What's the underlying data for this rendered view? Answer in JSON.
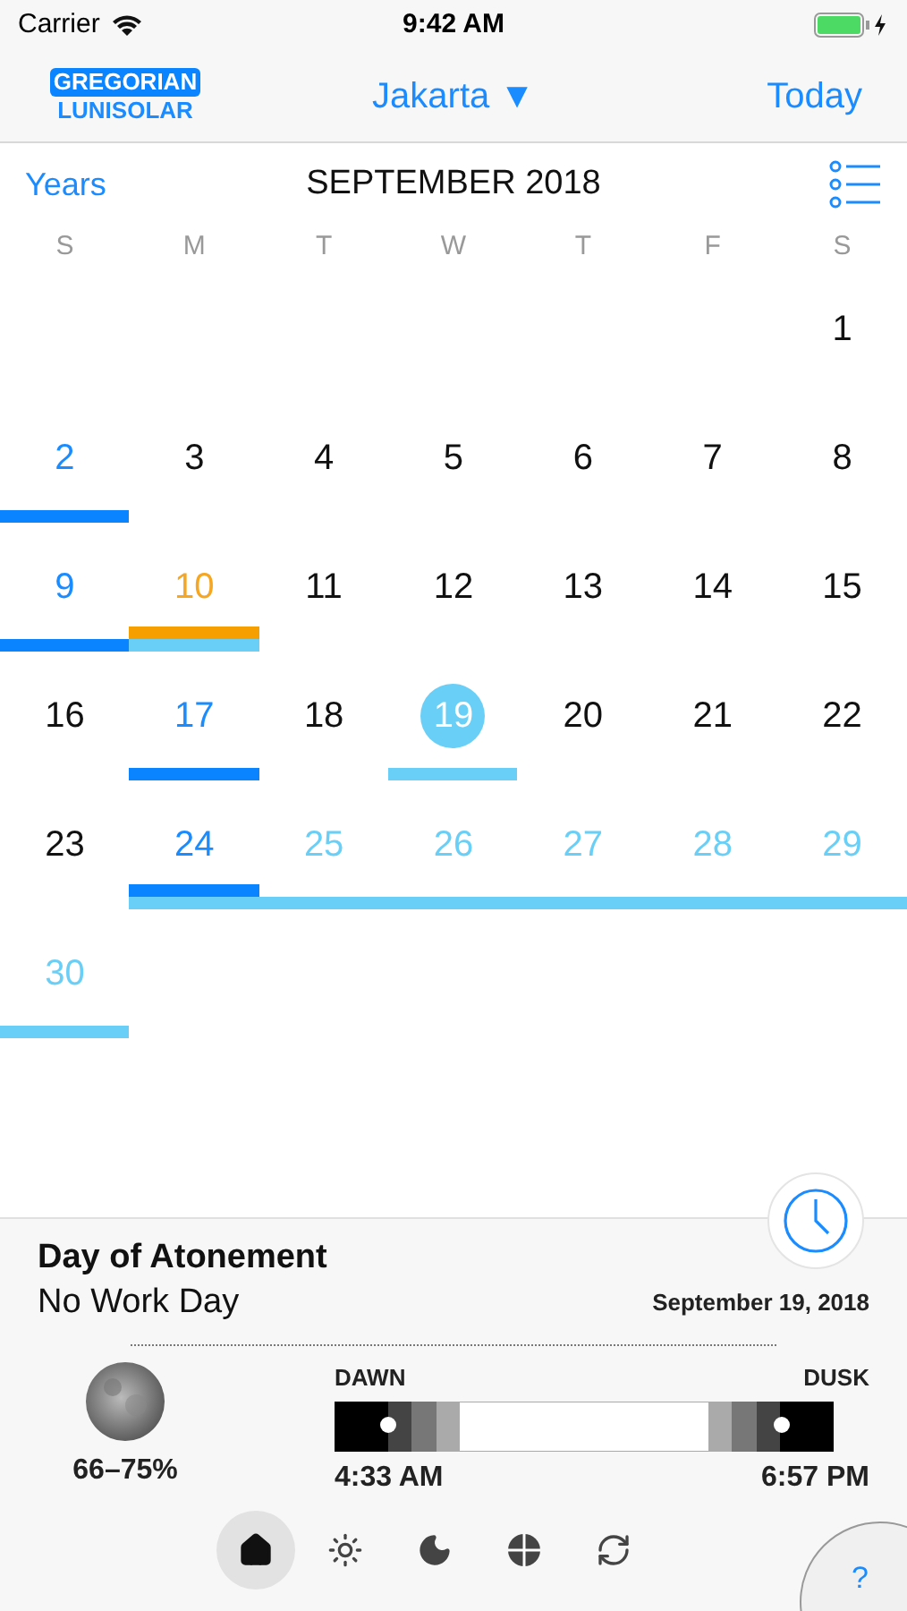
{
  "status_bar": {
    "carrier": "Carrier",
    "time": "9:42 AM"
  },
  "nav": {
    "calendars": [
      {
        "label": "GREGORIAN",
        "selected": true
      },
      {
        "label": "LUNISOLAR",
        "selected": false
      }
    ],
    "location": "Jakarta ▼",
    "today": "Today"
  },
  "month": {
    "years": "Years",
    "title": "SEPTEMBER 2018"
  },
  "weekdays": [
    "S",
    "M",
    "T",
    "W",
    "T",
    "F",
    "S"
  ],
  "weeks": [
    [
      {
        "label": "1",
        "color": "#111111",
        "selected": false
      }
    ],
    [
      {
        "label": "2",
        "color": "#1a8cff",
        "selected": false,
        "bars": [
          {
            "color": "#0a84ff"
          }
        ]
      },
      {
        "label": "3",
        "color": "#111111",
        "selected": false
      },
      {
        "label": "4",
        "color": "#111111",
        "selected": false
      },
      {
        "label": "5",
        "color": "#111111",
        "selected": false
      },
      {
        "label": "6",
        "color": "#111111",
        "selected": false
      },
      {
        "label": "7",
        "color": "#111111",
        "selected": false
      },
      {
        "label": "8",
        "color": "#111111",
        "selected": false
      }
    ],
    [
      {
        "label": "9",
        "color": "#1a8cff",
        "selected": false,
        "bars": [
          {
            "color": "#0a84ff"
          }
        ]
      },
      {
        "label": "10",
        "color": "#f5a623",
        "selected": false,
        "bars": [
          {
            "color": "#f5a000"
          },
          {
            "color": "#6acff6"
          }
        ]
      },
      {
        "label": "11",
        "color": "#111111",
        "selected": false
      },
      {
        "label": "12",
        "color": "#111111",
        "selected": false
      },
      {
        "label": "13",
        "color": "#111111",
        "selected": false
      },
      {
        "label": "14",
        "color": "#111111",
        "selected": false
      },
      {
        "label": "15",
        "color": "#111111",
        "selected": false
      }
    ],
    [
      {
        "label": "16",
        "color": "#111111",
        "selected": false
      },
      {
        "label": "17",
        "color": "#1a8cff",
        "selected": false,
        "bars": [
          {
            "color": "#0a84ff"
          }
        ]
      },
      {
        "label": "18",
        "color": "#111111",
        "selected": false
      },
      {
        "label": "19",
        "selected": true,
        "bars": [
          {
            "color": "#6acff6"
          }
        ]
      },
      {
        "label": "20",
        "color": "#111111",
        "selected": false
      },
      {
        "label": "21",
        "color": "#111111",
        "selected": false
      },
      {
        "label": "22",
        "color": "#111111",
        "selected": false
      }
    ],
    [
      {
        "label": "23",
        "color": "#111111",
        "selected": false
      },
      {
        "label": "24",
        "color": "#1a8cff",
        "selected": false,
        "bars": [
          {
            "color": "#0a84ff"
          },
          {
            "color": "#6acff6"
          }
        ]
      },
      {
        "label": "25",
        "color": "#6acff6",
        "selected": false,
        "bars": [
          {
            "color": "#6acff6"
          }
        ]
      },
      {
        "label": "26",
        "color": "#6acff6",
        "selected": false,
        "bars": [
          {
            "color": "#6acff6"
          }
        ]
      },
      {
        "label": "27",
        "color": "#6acff6",
        "selected": false,
        "bars": [
          {
            "color": "#6acff6"
          }
        ]
      },
      {
        "label": "28",
        "color": "#6acff6",
        "selected": false,
        "bars": [
          {
            "color": "#6acff6"
          }
        ]
      },
      {
        "label": "29",
        "color": "#6acff6",
        "selected": false,
        "bars": [
          {
            "color": "#6acff6"
          }
        ]
      }
    ],
    [
      {
        "label": "30",
        "color": "#6acff6",
        "selected": false,
        "bars": [
          {
            "color": "#6acff6"
          }
        ]
      }
    ]
  ],
  "detail": {
    "title": "Day of Atonement",
    "subtitle": "No Work Day",
    "date": "September 19, 2018",
    "moon_phase": "66–75%",
    "dawn_label": "DAWN",
    "dusk_label": "DUSK",
    "dawn_time": "4:33 AM",
    "dusk_time": "6:57 PM"
  },
  "tabs": [
    {
      "kind": "home",
      "selected": true
    },
    {
      "kind": "sun",
      "selected": false
    },
    {
      "kind": "moon",
      "selected": false
    },
    {
      "kind": "globe",
      "selected": false
    },
    {
      "kind": "refresh",
      "selected": false
    }
  ],
  "help": "?"
}
